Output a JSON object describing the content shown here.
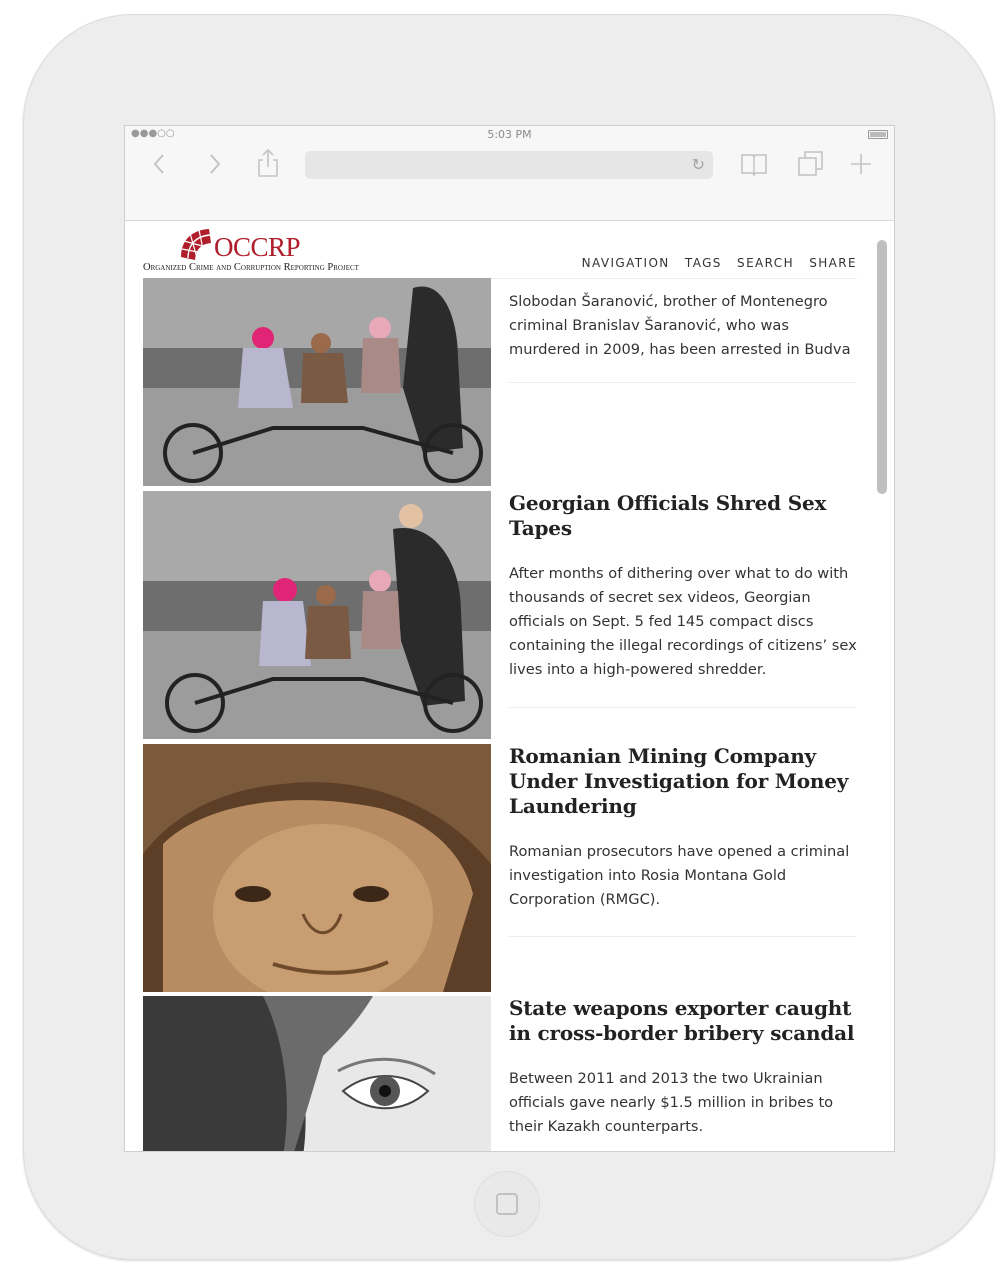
{
  "status_bar": {
    "signal": "●●●○○",
    "time": "5:03 PM"
  },
  "browser": {
    "back_icon": "back-chevron-icon",
    "forward_icon": "forward-chevron-icon",
    "share_icon": "share-icon",
    "url": "",
    "reload_icon": "reload-icon",
    "bookmarks_icon": "book-icon",
    "tabs_icon": "tabs-icon",
    "new_tab_icon": "plus-icon"
  },
  "site": {
    "logo_text": "OCCRP",
    "logo_subtitle": "Organized Crime and Corruption Reporting Project",
    "brand_color": "#b01e2b",
    "nav": [
      "NAVIGATION",
      "TAGS",
      "SEARCH",
      "SHARE"
    ]
  },
  "articles": [
    {
      "title": "",
      "summary": "Slobodan Šaranović, brother of Montenegro criminal Branislav Šaranović, who was murdered in 2009, has been arrested in Budva",
      "image": "children-on-tandem-bicycle"
    },
    {
      "title": "Georgian Officials Shred Sex Tapes",
      "summary": "After months of dithering over what to do with thousands of secret sex videos, Georgian officials on Sept. 5 fed 145 compact discs containing the illegal recordings of citizens’ sex lives into a high-powered shredder.",
      "image": "children-on-tandem-bicycle"
    },
    {
      "title": "Romanian Mining Company Under Investigation for Money Laundering",
      "summary": "Romanian prosecutors have opened a criminal investigation into Rosia Montana Gold Corporation (RMGC).",
      "image": "elderly-woman-in-hat-sepia"
    },
    {
      "title": "State weapons exporter caught in cross-border bribery scandal",
      "summary": "Between 2011 and 2013 the two Ukrainian officials gave nearly $1.5 million in bribes to their Kazakh counterparts.",
      "image": "woman-eye-closeup-bw"
    }
  ]
}
